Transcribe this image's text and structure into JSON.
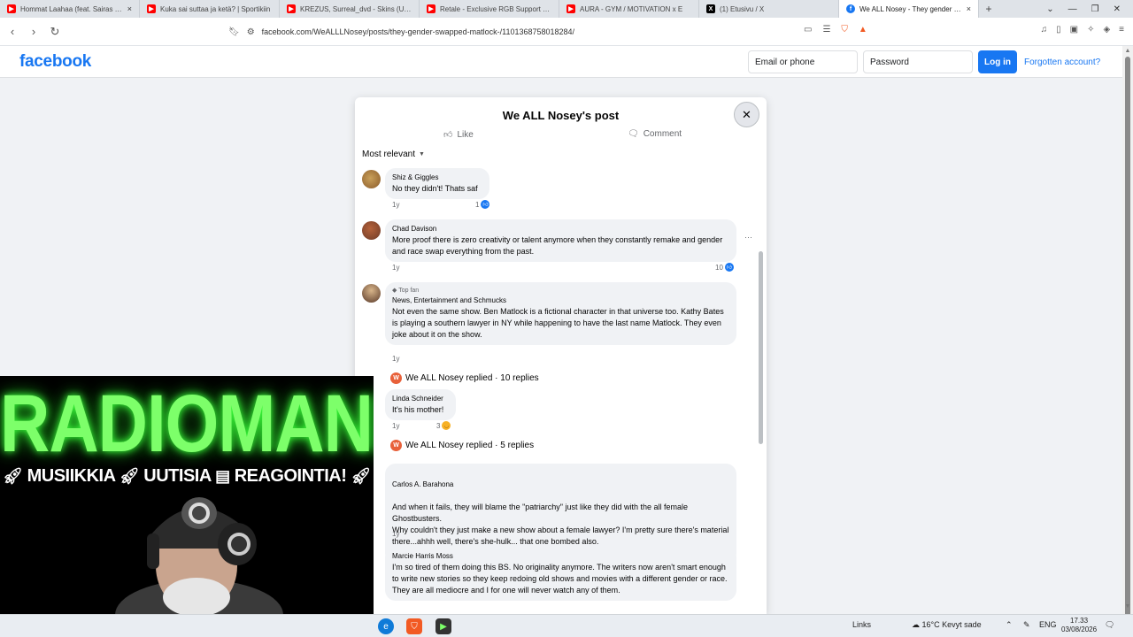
{
  "browser": {
    "tabs": [
      {
        "title": "Hommat Laahaa (feat. Sairas T) - Yo",
        "icon": "youtube-icon",
        "active": false
      },
      {
        "title": "Kuka sai suttaa ja ketä? | Sportikiin",
        "icon": "youtube-icon",
        "active": false
      },
      {
        "title": "KREZUS, Surreal_dvd - Skins (Ultra O",
        "icon": "youtube-icon",
        "active": false
      },
      {
        "title": "Retale - Exclusive RGB Support (w/",
        "icon": "youtube-icon",
        "active": false
      },
      {
        "title": "AURA - GYM / MOTIVATION x E",
        "icon": "youtube-icon",
        "active": false
      },
      {
        "title": "(1) Etusivu / X",
        "icon": "x-icon",
        "active": false
      },
      {
        "title": "We ALL Nosey - They gender sw",
        "icon": "facebook-icon",
        "active": true
      }
    ],
    "url": "facebook.com/WeALLLNosey/posts/they-gender-swapped-matlock-/1101368758018284/"
  },
  "fb_header": {
    "logo": "facebook",
    "email_placeholder": "Email or phone",
    "password_placeholder": "Password",
    "login_label": "Log in",
    "forgot_label": "Forgotten account?"
  },
  "modal": {
    "title": "We ALL Nosey's post",
    "like_label": "Like",
    "comment_label": "Comment",
    "sort_label": "Most relevant",
    "comments": [
      {
        "name": "Shiz & Giggles",
        "text": "No they didn't! Thats saf",
        "time": "1y",
        "reactions": "1"
      },
      {
        "name": "Chad Davison",
        "text": "More proof there is zero creativity or talent anymore when they constantly remake and gender and race swap everything from the past.",
        "time": "1y",
        "reactions": "10"
      },
      {
        "badge": "Top fan",
        "name": "News, Entertainment and Schmucks",
        "text": "Not even the same show. Ben Matlock is a fictional character in that universe too. Kathy Bates is playing a southern lawyer in NY while happening to have the last name Matlock. They even joke about it on the show.",
        "time": "1y",
        "replies": "We ALL Nosey replied · 10 replies"
      },
      {
        "name": "Linda Schneider",
        "text": "It's his mother!",
        "time": "1y",
        "reactions": "3",
        "replies": "We ALL Nosey replied · 5 replies"
      },
      {
        "name": "Carlos A. Barahona",
        "text": "And when it fails, they will blame the \"patriarchy\" just like they did with the all female Ghostbusters.\nWhy couldn't they just make a new show about a female lawyer? I'm pretty sure there's material there...ahhh well, there's she-hulk... that one bombed also.",
        "time": "1y"
      },
      {
        "name": "Marcie Harris Moss",
        "text": "I'm so tired of them doing this BS. No originality anymore. The writers now aren't smart enough to write new stories so they keep redoing old shows and movies with a different gender or race. They are all mediocre and I for one will never watch any of them."
      }
    ]
  },
  "overlay": {
    "title": "RADIOMANE",
    "subtitle_parts": [
      "MUSIIKKIA",
      "UUTISIA",
      "REAGOINTIA!"
    ]
  },
  "taskbar": {
    "links_label": "Links",
    "weather": "16°C  Kevyt sade",
    "language": "ENG",
    "time": "17.33",
    "date": "03/08/2026"
  }
}
